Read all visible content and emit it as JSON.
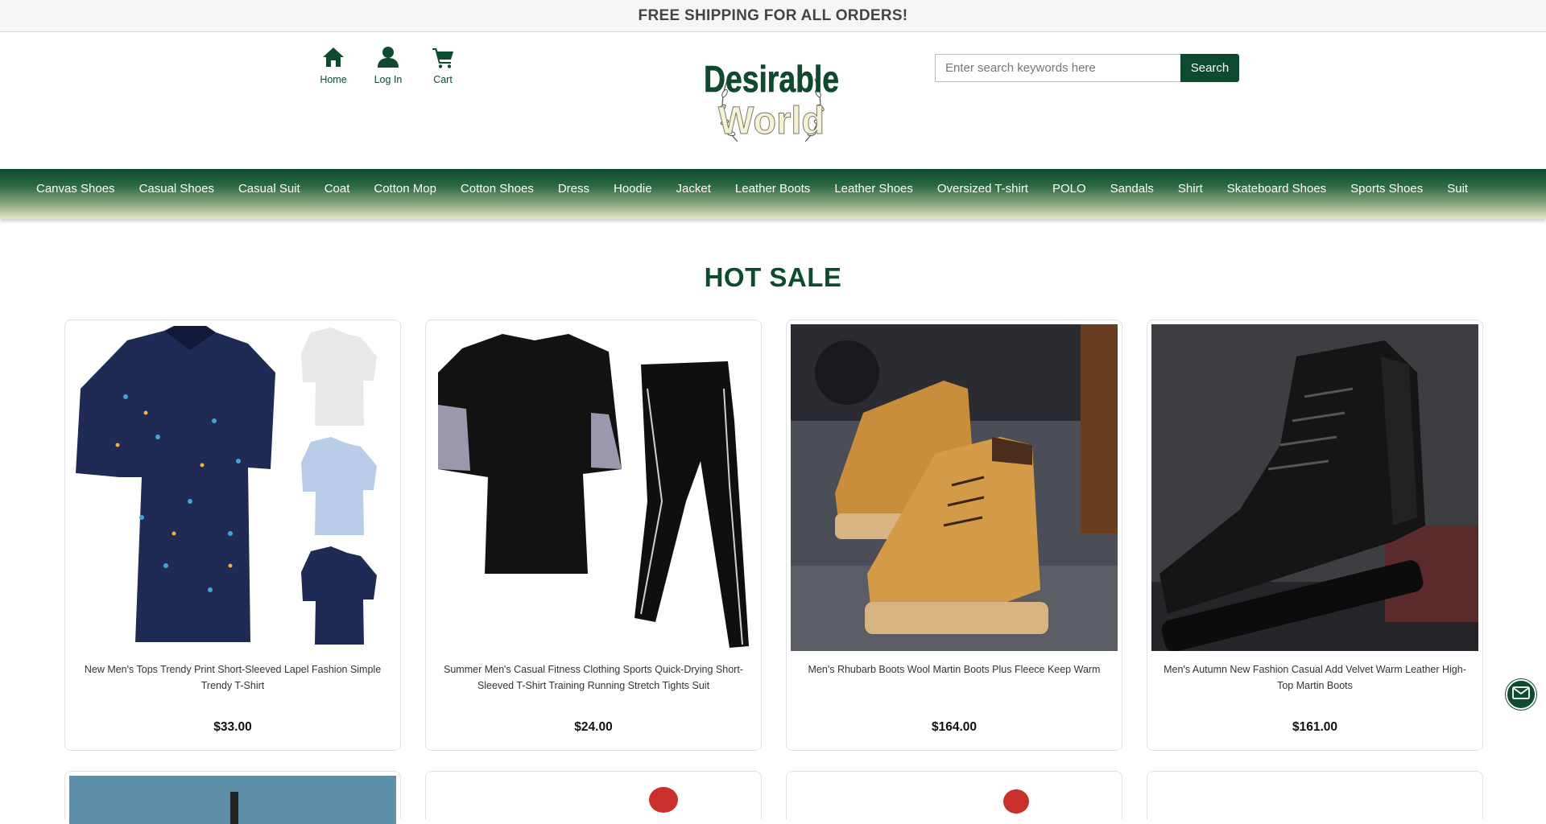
{
  "announcement": "FREE SHIPPING FOR ALL ORDERS!",
  "quick_nav": [
    {
      "label": "Home",
      "icon": "home-icon"
    },
    {
      "label": "Log In",
      "icon": "user-icon"
    },
    {
      "label": "Cart",
      "icon": "cart-icon"
    }
  ],
  "brand": {
    "line1": "Desirable",
    "line2": "World",
    "primary_color": "#0e4a2f"
  },
  "search": {
    "placeholder": "Enter search keywords here",
    "value": "",
    "button_label": "Search"
  },
  "categories": [
    "Canvas Shoes",
    "Casual Shoes",
    "Casual Suit",
    "Coat",
    "Cotton Mop",
    "Cotton Shoes",
    "Dress",
    "Hoodie",
    "Jacket",
    "Leather Boots",
    "Leather Shoes",
    "Oversized T-shirt",
    "POLO",
    "Sandals",
    "Shirt",
    "Skateboard Shoes",
    "Sports Shoes",
    "Suit"
  ],
  "hot_sale": {
    "title": "HOT SALE",
    "products": [
      {
        "name": "New Men's Tops Trendy Print Short-Sleeved Lapel Fashion Simple Trendy T-Shirt",
        "price": "$33.00",
        "image": "navy-polo-shirt"
      },
      {
        "name": "Summer Men's Casual Fitness Clothing Sports Quick-Drying Short-Sleeved T-Shirt Training Running Stretch Tights Suit",
        "price": "$24.00",
        "image": "black-compression-suit"
      },
      {
        "name": "Men's Rhubarb Boots Wool Martin Boots Plus Fleece Keep Warm",
        "price": "$164.00",
        "image": "tan-martin-boots"
      },
      {
        "name": "Men's Autumn New Fashion Casual Add Velvet Warm Leather High-Top Martin Boots",
        "price": "$161.00",
        "image": "black-leather-boot"
      }
    ]
  },
  "contact_fab": {
    "icon": "mail-icon"
  }
}
